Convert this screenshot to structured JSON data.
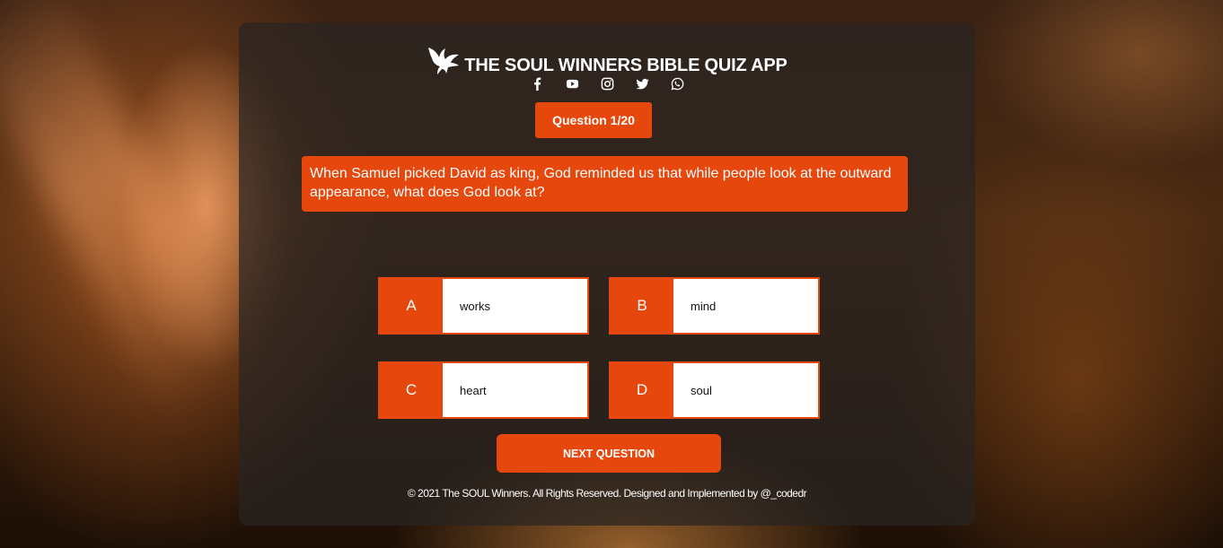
{
  "header": {
    "title": "THE SOUL WINNERS BIBLE QUIZ APP",
    "logo_icon": "dove-icon"
  },
  "socials": [
    {
      "name": "facebook",
      "icon": "facebook-icon"
    },
    {
      "name": "youtube",
      "icon": "youtube-icon"
    },
    {
      "name": "instagram",
      "icon": "instagram-icon"
    },
    {
      "name": "twitter",
      "icon": "twitter-icon"
    },
    {
      "name": "whatsapp",
      "icon": "whatsapp-icon"
    }
  ],
  "quiz": {
    "counter": "Question 1/20",
    "question": "When Samuel picked David as king, God reminded us that while people look at the outward appearance, what does God look at?",
    "options": [
      {
        "letter": "A",
        "text": "works"
      },
      {
        "letter": "B",
        "text": "mind"
      },
      {
        "letter": "C",
        "text": "heart"
      },
      {
        "letter": "D",
        "text": "soul"
      }
    ],
    "next_label": "NEXT QUESTION"
  },
  "footer": {
    "text": "© 2021 The SOUL Winners. All Rights Reserved. Designed and Implemented by @_codedr"
  },
  "colors": {
    "accent": "#e5470c",
    "card": "#282422",
    "text": "#ffffff"
  }
}
